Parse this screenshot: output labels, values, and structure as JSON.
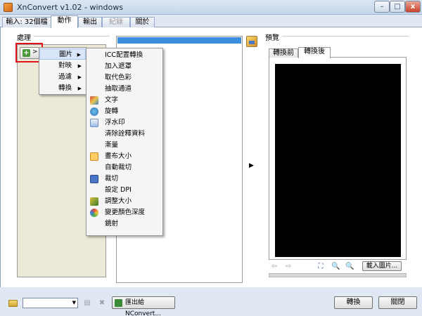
{
  "window": {
    "title": "XnConvert v1.02 - windows",
    "min_glyph": "–",
    "max_glyph": "□",
    "close_glyph": "x"
  },
  "main_tabs": [
    "輸入: 32個檔",
    "動作",
    "輸出",
    "紀錄",
    "關於"
  ],
  "main_tabs_active": "動作",
  "main_tabs_disabled": "紀錄",
  "processing": {
    "label": "處理",
    "add_button_arrow": ">"
  },
  "menu_level1": [
    {
      "label": "圖片",
      "submenu": "▶",
      "highlighted": true
    },
    {
      "label": "對映",
      "submenu": "▶"
    },
    {
      "label": "過濾",
      "submenu": "▶"
    },
    {
      "label": "轉換",
      "submenu": "▶"
    }
  ],
  "menu_level2": [
    {
      "label": "ICC配置轉換",
      "icon": ""
    },
    {
      "label": "加入遮罩",
      "icon": ""
    },
    {
      "label": "取代色彩",
      "icon": ""
    },
    {
      "label": "抽取通道",
      "icon": ""
    },
    {
      "label": "文字",
      "icon": "paint-icon"
    },
    {
      "label": "旋轉",
      "icon": "rotate-icon"
    },
    {
      "label": "浮水印",
      "icon": "watermark-icon"
    },
    {
      "label": "清除詮釋資料",
      "icon": ""
    },
    {
      "label": "漸量",
      "icon": ""
    },
    {
      "label": "畫布大小",
      "icon": "canvas-icon"
    },
    {
      "label": "自動裁切",
      "icon": ""
    },
    {
      "label": "裁切",
      "icon": "crop-icon"
    },
    {
      "label": "設定 DPI",
      "icon": ""
    },
    {
      "label": "調整大小",
      "icon": "resize-icon"
    },
    {
      "label": "變更顏色深度",
      "icon": "color-depth-icon"
    },
    {
      "label": "鏡射",
      "icon": ""
    }
  ],
  "preview": {
    "label": "預覽",
    "tabs": [
      "轉換前",
      "轉換後"
    ],
    "active_tab": "轉換後",
    "load_button": "載入圖片...",
    "expand_arrow": "▶"
  },
  "bottom": {
    "combo_value": "",
    "combo_arrow": "▼",
    "export_button": "匯出給NConvert...",
    "convert_button": "轉換",
    "close_button": "關閉"
  },
  "glyphs": {
    "back": "⇦",
    "forward": "⇨",
    "fit": "⛶",
    "zoom_out": "🔍",
    "zoom_in": "🔍",
    "save": "▤",
    "delete": "✖"
  },
  "colors": {
    "selection_bar": "#3b8de0",
    "highlight_box": "#e1131a",
    "preview_background": "#000000"
  }
}
